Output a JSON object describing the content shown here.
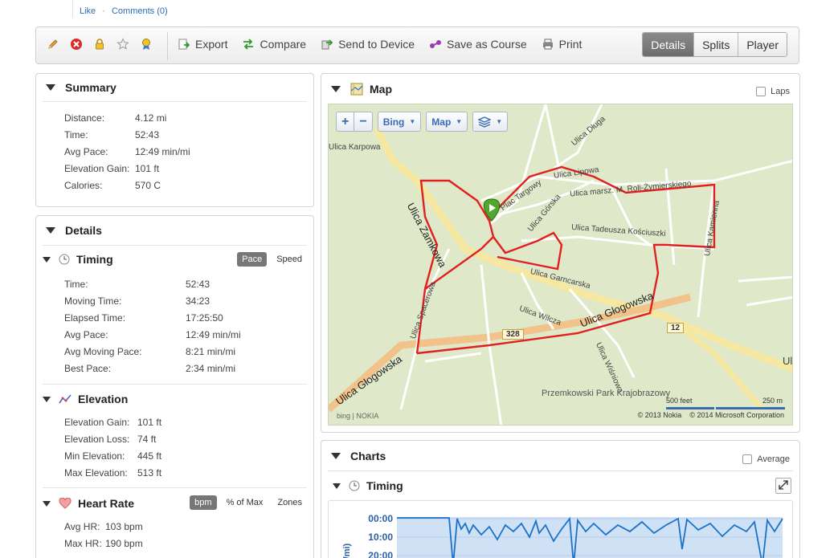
{
  "top_links": {
    "like": "Like",
    "separator": "·",
    "comments": "Comments (0)"
  },
  "toolbar": {
    "icons": [
      "pencil-icon",
      "delete-icon",
      "lock-icon",
      "star-icon",
      "award-icon"
    ],
    "actions": [
      {
        "label": "Export",
        "icon": "export-icon"
      },
      {
        "label": "Compare",
        "icon": "compare-icon"
      },
      {
        "label": "Send to Device",
        "icon": "send-to-device-icon"
      },
      {
        "label": "Save as Course",
        "icon": "course-icon"
      },
      {
        "label": "Print",
        "icon": "print-icon"
      }
    ],
    "views": [
      "Details",
      "Splits",
      "Player"
    ],
    "active_view": "Details"
  },
  "summary": {
    "title": "Summary",
    "rows": [
      {
        "label": "Distance:",
        "value": "4.12 mi"
      },
      {
        "label": "Time:",
        "value": "52:43"
      },
      {
        "label": "Avg Pace:",
        "value": "12:49 min/mi"
      },
      {
        "label": "Elevation Gain:",
        "value": "101 ft"
      },
      {
        "label": "Calories:",
        "value": "570 C"
      }
    ]
  },
  "details": {
    "title": "Details",
    "timing": {
      "title": "Timing",
      "toggle": [
        "Pace",
        "Speed"
      ],
      "active": "Pace",
      "rows": [
        {
          "label": "Time:",
          "value": "52:43"
        },
        {
          "label": "Moving Time:",
          "value": "34:23"
        },
        {
          "label": "Elapsed Time:",
          "value": "17:25:50"
        },
        {
          "label": "Avg Pace:",
          "value": "12:49 min/mi"
        },
        {
          "label": "Avg Moving Pace:",
          "value": "8:21 min/mi"
        },
        {
          "label": "Best Pace:",
          "value": "2:34 min/mi"
        }
      ]
    },
    "elevation": {
      "title": "Elevation",
      "rows": [
        {
          "label": "Elevation Gain:",
          "value": "101 ft"
        },
        {
          "label": "Elevation Loss:",
          "value": "74 ft"
        },
        {
          "label": "Min Elevation:",
          "value": "445 ft"
        },
        {
          "label": "Max Elevation:",
          "value": "513 ft"
        }
      ]
    },
    "heart_rate": {
      "title": "Heart Rate",
      "toggle": [
        "bpm",
        "% of Max",
        "Zones"
      ],
      "active": "bpm",
      "rows": [
        {
          "label": "Avg HR:",
          "value": "103 bpm"
        },
        {
          "label": "Max HR:",
          "value": "190 bpm"
        }
      ]
    }
  },
  "map": {
    "title": "Map",
    "laps_label": "Laps",
    "controls": {
      "zoom_in": "+",
      "zoom_out": "−",
      "provider": "Bing",
      "view": "Map"
    },
    "labels": {
      "karpowa": "Ulica Karpowa",
      "zamkowa": "Ulica Zamkowa",
      "targowy": "Plac Targowy",
      "gorska": "Ulica Górska",
      "lipowa": "Ulica Lipowa",
      "dluga": "Ulica Długa",
      "zymierskiego": "Ulica marsz. M. Roli-Żymierskiego",
      "kamienna": "Ulica Kamienna",
      "kosciuszki": "Ulica Tadeusza Kościuszki",
      "garncarska": "Ulica Garncarska",
      "glogowska": "Ulica Głogowska",
      "wilcza": "Ulica Wilcza",
      "wisniowa": "Ulica Wiśniowa",
      "spacerowa": "Ulica Spacerowa",
      "glogowska_w": "Ulica Głogowska",
      "park": "Przemkowski Park Krajobrazowy",
      "edge_right": "Ul"
    },
    "shields": {
      "r328": "328",
      "r12": "12"
    },
    "scale": {
      "feet": "500 feet",
      "meters": "250 m"
    },
    "credits": {
      "nokia": "© 2013 Nokia",
      "microsoft": "© 2014 Microsoft Corporation"
    },
    "logo": {
      "bing": "bing",
      "nokia": "NOKIA"
    },
    "route_color": "#e02020"
  },
  "charts": {
    "title": "Charts",
    "average_label": "Average",
    "timing_title": "Timing",
    "y_ticks": [
      "00:00",
      "10:00",
      "20:00"
    ],
    "y_unit": "(/mi)",
    "series_color": "#1a73c9",
    "fill_color": "#cfe1f5"
  }
}
